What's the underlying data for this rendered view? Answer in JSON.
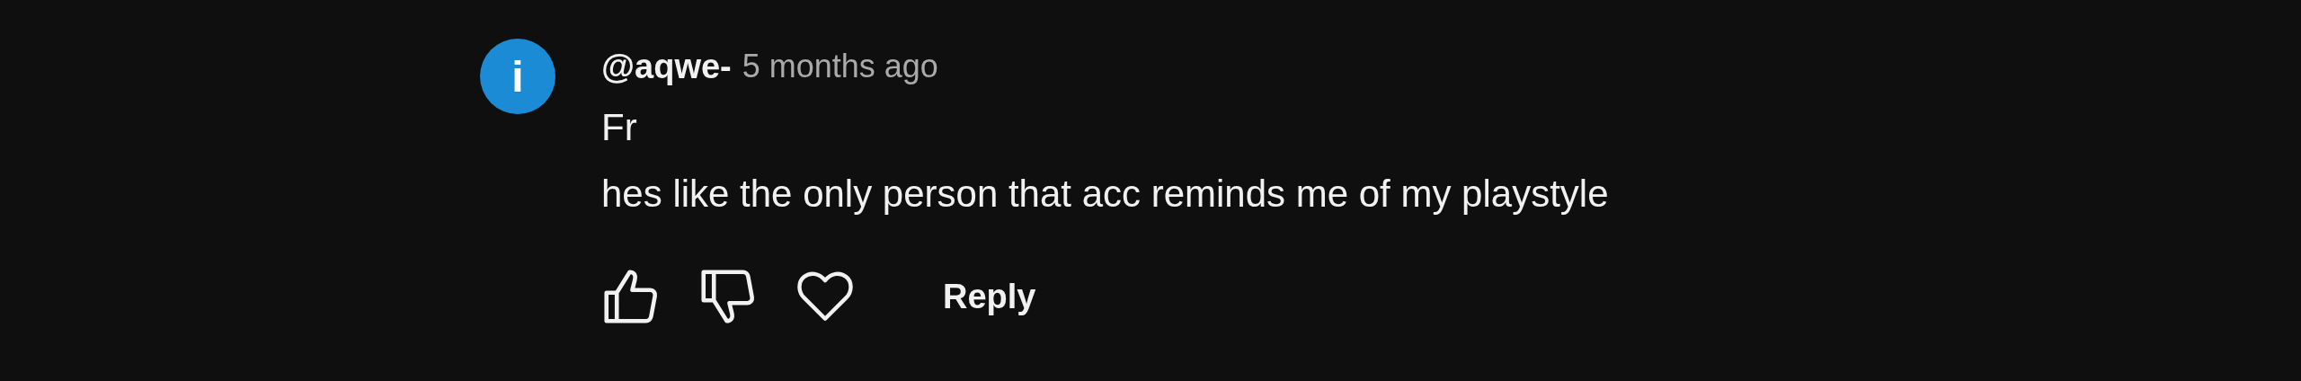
{
  "comment": {
    "avatar_letter": "i",
    "author": "@aqwe-",
    "time": "5 months ago",
    "lines": [
      "Fr",
      "hes like the only person that acc reminds me of my playstyle"
    ],
    "reply_label": "Reply"
  }
}
